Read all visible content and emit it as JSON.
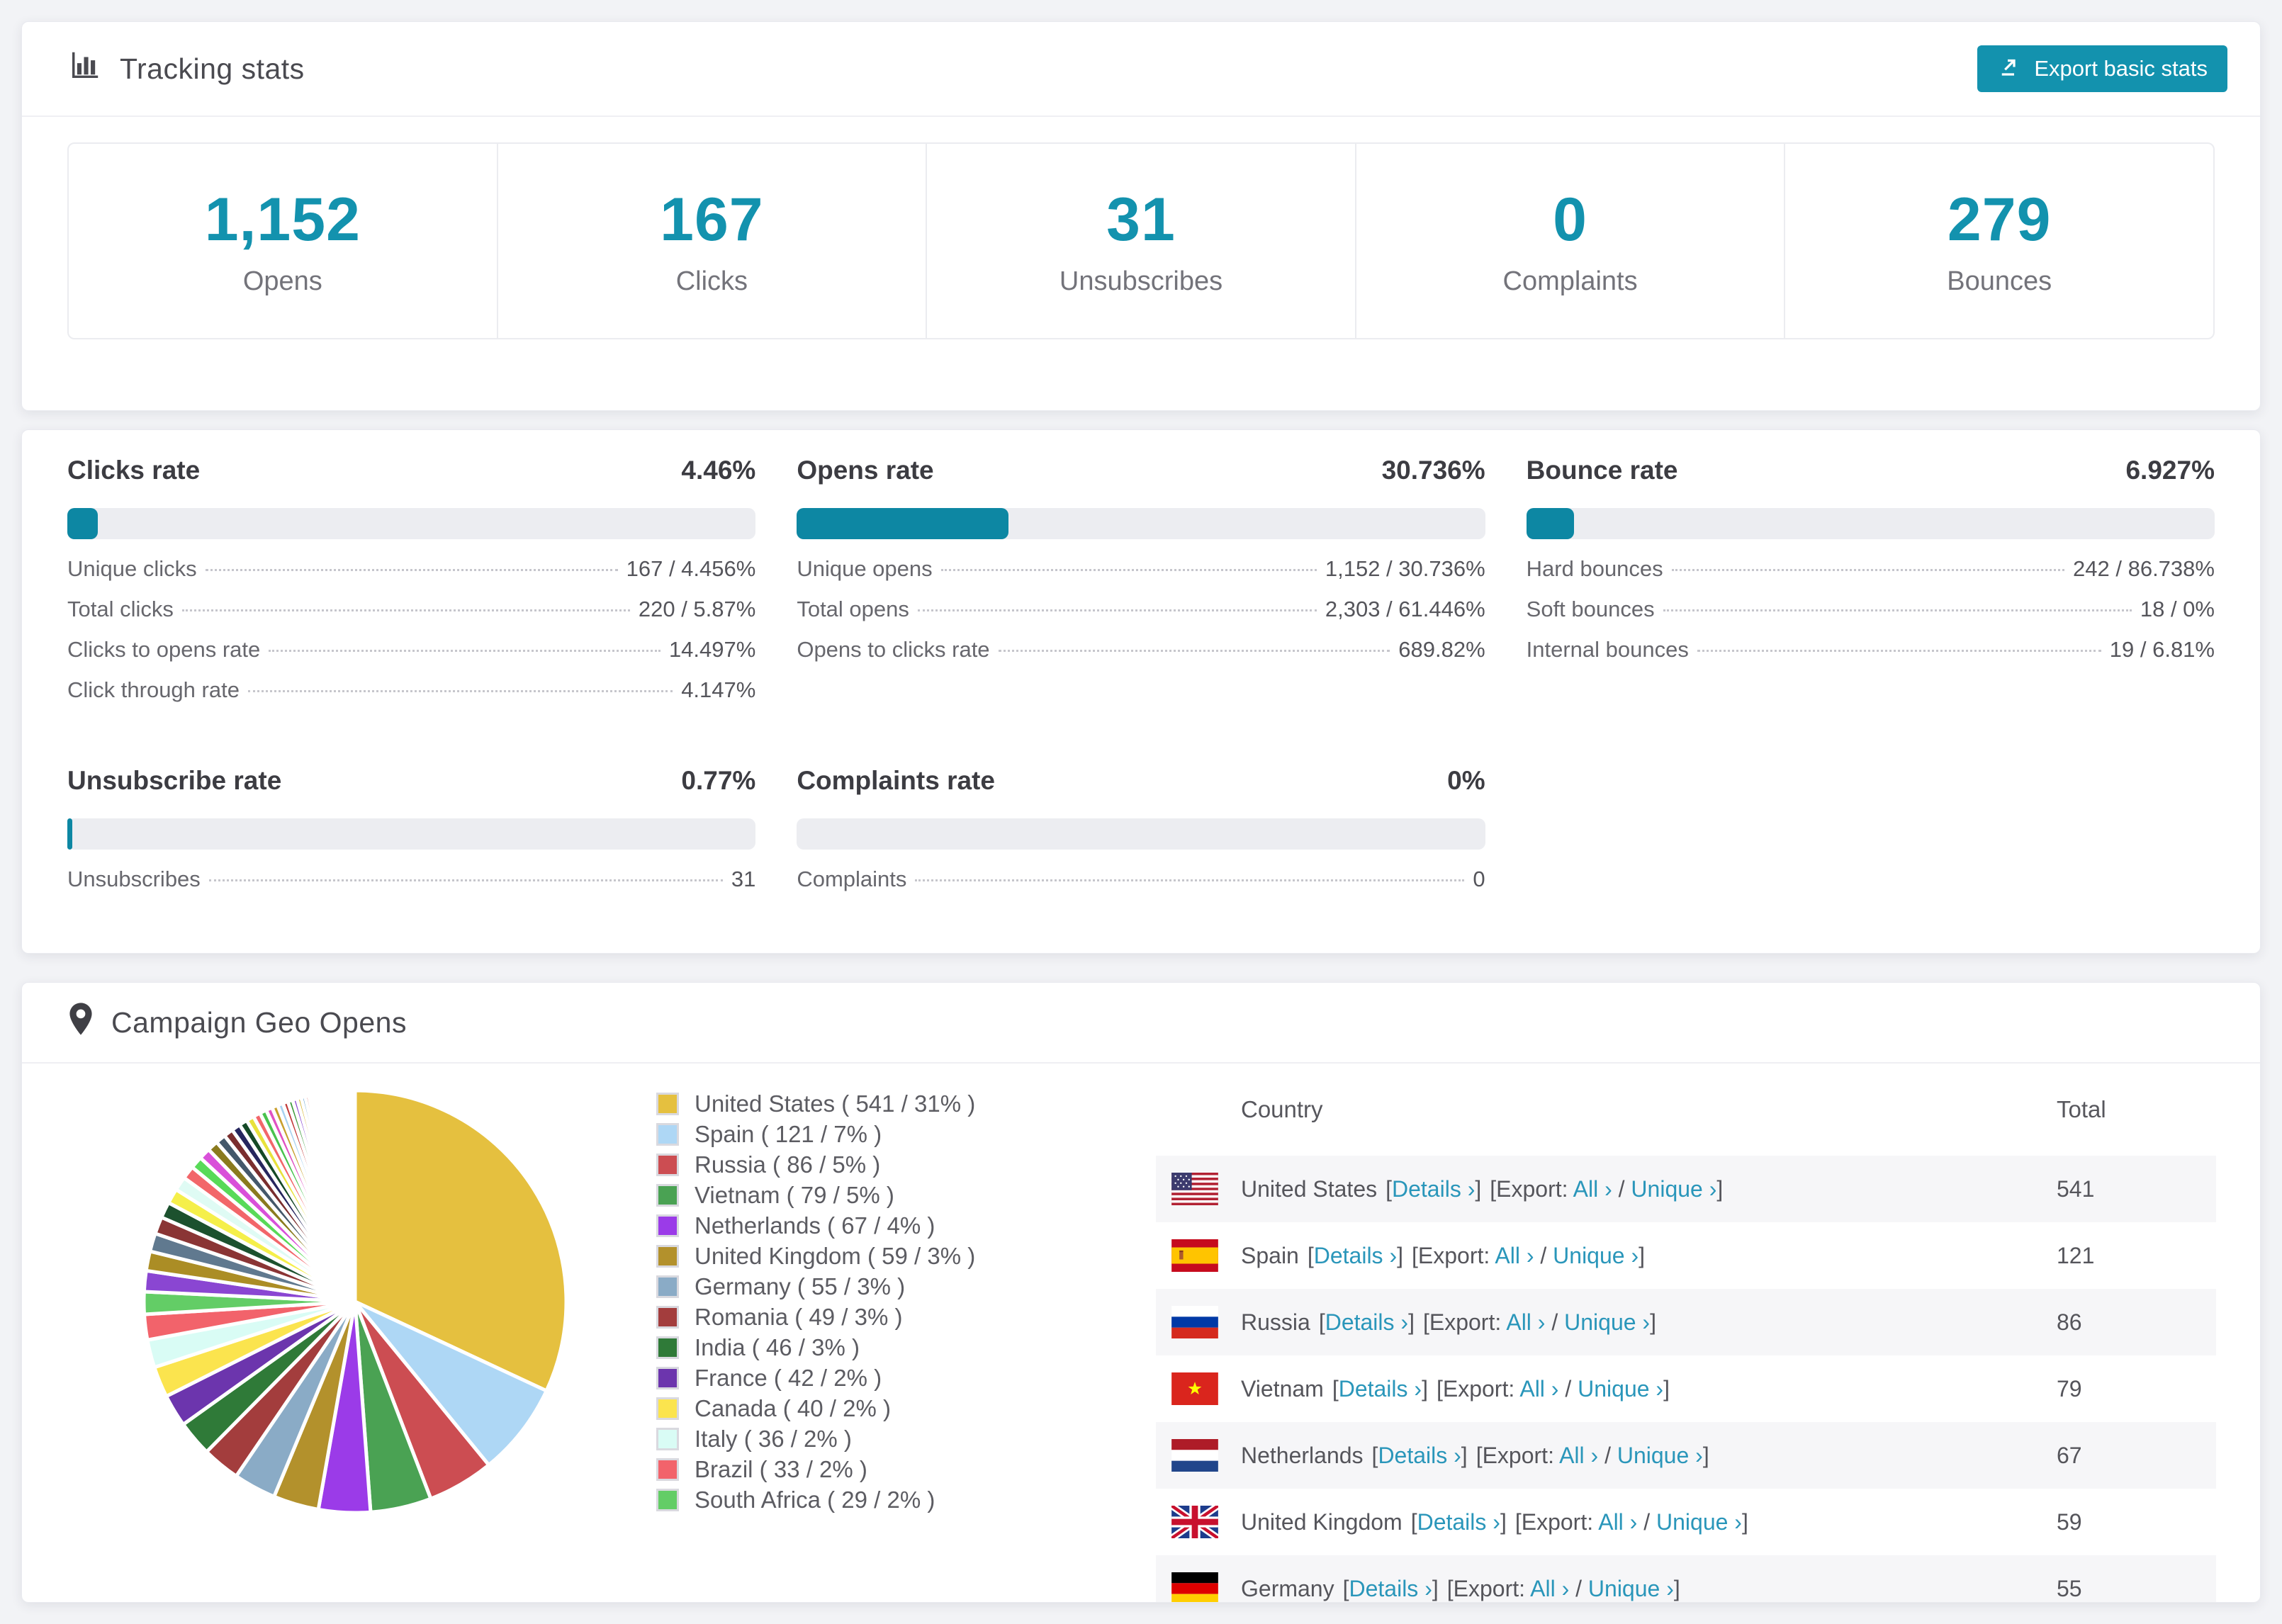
{
  "theme": {
    "accent": "#1392ae",
    "page_bg": "#f2f3f6",
    "bar_track": "#ecedf1",
    "link_color": "#2a96ba"
  },
  "tracking_card": {
    "title": "Tracking stats",
    "export_button_label": "Export basic stats",
    "stats": [
      {
        "value": "1,152",
        "label": "Opens"
      },
      {
        "value": "167",
        "label": "Clicks"
      },
      {
        "value": "31",
        "label": "Unsubscribes"
      },
      {
        "value": "0",
        "label": "Complaints"
      },
      {
        "value": "279",
        "label": "Bounces"
      }
    ]
  },
  "rates_card": {
    "blocks": [
      {
        "title": "Clicks rate",
        "value": "4.46%",
        "percent": 4.46,
        "rows": [
          {
            "label": "Unique clicks",
            "value": "167 / 4.456%"
          },
          {
            "label": "Total clicks",
            "value": "220 / 5.87%"
          },
          {
            "label": "Clicks to opens rate",
            "value": "14.497%"
          },
          {
            "label": "Click through rate",
            "value": "4.147%"
          }
        ]
      },
      {
        "title": "Opens rate",
        "value": "30.736%",
        "percent": 30.736,
        "rows": [
          {
            "label": "Unique opens",
            "value": "1,152 / 30.736%"
          },
          {
            "label": "Total opens",
            "value": "2,303 / 61.446%"
          },
          {
            "label": "Opens to clicks rate",
            "value": "689.82%"
          }
        ]
      },
      {
        "title": "Bounce rate",
        "value": "6.927%",
        "percent": 6.927,
        "rows": [
          {
            "label": "Hard bounces",
            "value": "242 / 86.738%"
          },
          {
            "label": "Soft bounces",
            "value": "18 / 0%"
          },
          {
            "label": "Internal bounces",
            "value": "19 / 6.81%"
          }
        ]
      },
      {
        "title": "Unsubscribe rate",
        "value": "0.77%",
        "percent": 0.77,
        "rows": [
          {
            "label": "Unsubscribes",
            "value": "31"
          }
        ]
      },
      {
        "title": "Complaints rate",
        "value": "0%",
        "percent": 0,
        "rows": [
          {
            "label": "Complaints",
            "value": "0"
          }
        ]
      }
    ]
  },
  "geo_card": {
    "title": "Campaign Geo Opens",
    "chart_data": {
      "type": "pie",
      "title": "Campaign Geo Opens",
      "start_angle_deg": 0,
      "direction": "clockwise",
      "slices": [
        {
          "label": "United States",
          "value": 541,
          "pct": "31%",
          "color": "#e5c03f"
        },
        {
          "label": "Spain",
          "value": 121,
          "pct": "7%",
          "color": "#aed7f5"
        },
        {
          "label": "Russia",
          "value": 86,
          "pct": "5%",
          "color": "#cc4d52"
        },
        {
          "label": "Vietnam",
          "value": 79,
          "pct": "5%",
          "color": "#4aa253"
        },
        {
          "label": "Netherlands",
          "value": 67,
          "pct": "4%",
          "color": "#9b3be8"
        },
        {
          "label": "United Kingdom",
          "value": 59,
          "pct": "3%",
          "color": "#b3912c"
        },
        {
          "label": "Germany",
          "value": 55,
          "pct": "3%",
          "color": "#8aabc6"
        },
        {
          "label": "Romania",
          "value": 49,
          "pct": "3%",
          "color": "#a33d3d"
        },
        {
          "label": "India",
          "value": 46,
          "pct": "3%",
          "color": "#2f7a38"
        },
        {
          "label": "France",
          "value": 42,
          "pct": "2%",
          "color": "#6c35ad"
        },
        {
          "label": "Canada",
          "value": 40,
          "pct": "2%",
          "color": "#fbe44e"
        },
        {
          "label": "Italy",
          "value": 36,
          "pct": "2%",
          "color": "#d9fcf5"
        },
        {
          "label": "Brazil",
          "value": 33,
          "pct": "2%",
          "color": "#f2636b"
        },
        {
          "label": "South Africa",
          "value": 29,
          "pct": "2%",
          "color": "#63cd66"
        }
      ],
      "other_slices": {
        "note": "many unlabeled small country slices tapering clockwise to hairlines",
        "approx_total": 410,
        "count": 55,
        "start_value": 27,
        "decay": 0.936,
        "palette": [
          "#8a46d2",
          "#ab8d25",
          "#60798f",
          "#8a3535",
          "#1c512e",
          "#f5ef4a",
          "#dffbf4",
          "#f2666a",
          "#58da58",
          "#d950d9",
          "#8a7a1e",
          "#44586a",
          "#7a2e2e",
          "#26265e",
          "#154a26",
          "#e8e23c",
          "#f2666a",
          "#49c24e",
          "#e052c2",
          "#c8a02e",
          "#a8d2f0",
          "#c23a3a",
          "#3a9a3a",
          "#8a46d2",
          "#d4b32e",
          "#5599cc",
          "#cc3a3a",
          "#44aa44",
          "#aa44cc",
          "#ccaa33"
        ]
      }
    },
    "legend": [
      {
        "label": "United States ( 541 / 31% )",
        "color": "#e5c03f"
      },
      {
        "label": "Spain ( 121 / 7% )",
        "color": "#aed7f5"
      },
      {
        "label": "Russia ( 86 / 5% )",
        "color": "#cc4d52"
      },
      {
        "label": "Vietnam ( 79 / 5% )",
        "color": "#4aa253"
      },
      {
        "label": "Netherlands ( 67 / 4% )",
        "color": "#9b3be8"
      },
      {
        "label": "United Kingdom ( 59 / 3% )",
        "color": "#b3912c"
      },
      {
        "label": "Germany ( 55 / 3% )",
        "color": "#8aabc6"
      },
      {
        "label": "Romania ( 49 / 3% )",
        "color": "#a33d3d"
      },
      {
        "label": "India ( 46 / 3% )",
        "color": "#2f7a38"
      },
      {
        "label": "France ( 42 / 2% )",
        "color": "#6c35ad"
      },
      {
        "label": "Canada ( 40 / 2% )",
        "color": "#fbe44e"
      },
      {
        "label": "Italy ( 36 / 2% )",
        "color": "#d9fcf5"
      },
      {
        "label": "Brazil ( 33 / 2% )",
        "color": "#f2636b"
      },
      {
        "label": "South Africa ( 29 / 2% )",
        "color": "#63cd66"
      }
    ],
    "table": {
      "headers": [
        "Country",
        "Total"
      ],
      "punct": {
        "lb": "[",
        "rb": "]",
        "slash": " / "
      },
      "links": {
        "details": "Details ›",
        "export_prefix": "Export: ",
        "all": "All ›",
        "unique": "Unique ›"
      },
      "rows": [
        {
          "country": "United States",
          "total": "541",
          "flag": "us"
        },
        {
          "country": "Spain",
          "total": "121",
          "flag": "es"
        },
        {
          "country": "Russia",
          "total": "86",
          "flag": "ru"
        },
        {
          "country": "Vietnam",
          "total": "79",
          "flag": "vn"
        },
        {
          "country": "Netherlands",
          "total": "67",
          "flag": "nl"
        },
        {
          "country": "United Kingdom",
          "total": "59",
          "flag": "gb"
        },
        {
          "country": "Germany",
          "total": "55",
          "flag": "de"
        }
      ]
    }
  }
}
